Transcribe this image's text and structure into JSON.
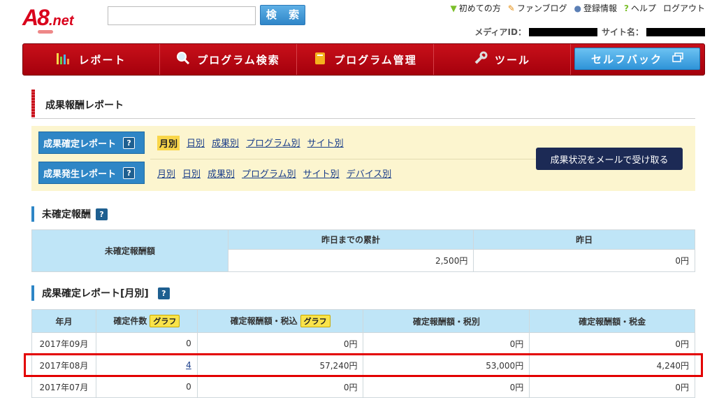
{
  "header": {
    "logo_text": "A8.net",
    "search_button": "検 索",
    "search_value": "",
    "links": [
      {
        "label": "初めての方",
        "icon": "beginner-icon"
      },
      {
        "label": "ファンブログ",
        "icon": "pencil-icon"
      },
      {
        "label": "登録情報",
        "icon": "user-icon"
      },
      {
        "label": "ヘルプ",
        "icon": "question-icon"
      },
      {
        "label": "ログアウト",
        "icon": ""
      }
    ],
    "media_id_label": "メディアID：",
    "site_name_label": "サイト名："
  },
  "nav": {
    "items": [
      {
        "label": "レポート",
        "icon": "bar-chart-icon"
      },
      {
        "label": "プログラム検索",
        "icon": "magnifier-icon"
      },
      {
        "label": "プログラム管理",
        "icon": "folder-icon"
      },
      {
        "label": "ツール",
        "icon": "wrench-icon"
      }
    ],
    "cashback": "セルフバック"
  },
  "page_title": "成果報酬レポート",
  "reports": {
    "confirmed_label": "成果確定レポート",
    "confirmed_links": [
      "月別",
      "日別",
      "成果別",
      "プログラム別",
      "サイト別"
    ],
    "occurred_label": "成果発生レポート",
    "occurred_links": [
      "月別",
      "日別",
      "成果別",
      "プログラム別",
      "サイト別",
      "デバイス別"
    ],
    "mail_button": "成果状況をメールで受け取る"
  },
  "unconfirmed": {
    "heading": "未確定報酬",
    "row_header": "未確定報酬額",
    "col_cumulative": "昨日までの累計",
    "col_yesterday": "昨日",
    "cumulative_value": "2,500円",
    "yesterday_value": "0円"
  },
  "monthly": {
    "heading": "成果確定レポート[月別]",
    "columns": [
      "年月",
      "確定件数",
      "確定報酬額・税込",
      "確定報酬額・税別",
      "確定報酬額・税金"
    ],
    "graph_label": "グラフ",
    "rows": [
      {
        "month": "2017年09月",
        "count": "0",
        "incl": "0円",
        "excl": "0円",
        "tax": "0円"
      },
      {
        "month": "2017年08月",
        "count": "4",
        "incl": "57,240円",
        "excl": "53,000円",
        "tax": "4,240円"
      },
      {
        "month": "2017年07月",
        "count": "0",
        "incl": "0円",
        "excl": "0円",
        "tax": "0円"
      }
    ]
  }
}
